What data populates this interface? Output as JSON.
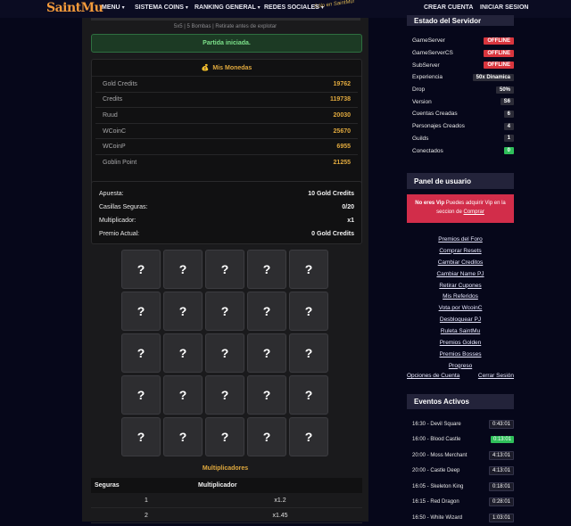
{
  "header": {
    "logo": "SaintMu",
    "logo_tag": "Sólo en SaintMu!",
    "nav": [
      {
        "label": "MENU"
      },
      {
        "label": "SISTEMA COINS"
      },
      {
        "label": "RANKING GENERAL"
      },
      {
        "label": "REDES SOCIALES"
      }
    ],
    "create_account": "CREAR CUENTA",
    "login": "INICIAR SESION"
  },
  "game": {
    "subtitle": "5x5 | 5 Bombas | Retirate antes de explotar",
    "alert": "Partida iniciada.",
    "coins_title": "Mis Monedas",
    "coins": [
      {
        "label": "Gold Credits",
        "value": "19762"
      },
      {
        "label": "Credits",
        "value": "119738"
      },
      {
        "label": "Ruud",
        "value": "20030"
      },
      {
        "label": "WCoinC",
        "value": "25670"
      },
      {
        "label": "WCoinP",
        "value": "6955"
      },
      {
        "label": "Goblin Point",
        "value": "21255"
      }
    ],
    "bet": [
      {
        "label": "Apuesta:",
        "value": "10 Gold Credits"
      },
      {
        "label": "Casillas Seguras:",
        "value": "0/20"
      },
      {
        "label": "Multiplicador:",
        "value": "x1"
      },
      {
        "label": "Premio Actual:",
        "value": "0 Gold Credits"
      }
    ],
    "cell_symbol": "?",
    "multipliers_title": "Multiplicadores",
    "multipliers_headers": [
      "Seguras",
      "Multiplicador"
    ],
    "multipliers": [
      {
        "safe": "1",
        "mult": "x1.2"
      },
      {
        "safe": "2",
        "mult": "x1.45"
      }
    ]
  },
  "sidebar": {
    "server_title": "Estado del Servidor",
    "server": [
      {
        "label": "GameServer",
        "value": "OFFLINE",
        "color": "red"
      },
      {
        "label": "GameServerCS",
        "value": "OFFLINE",
        "color": "red"
      },
      {
        "label": "SubServer",
        "value": "OFFLINE",
        "color": "red"
      },
      {
        "label": "Experiencia",
        "value": "50x Dinamica",
        "color": "gray"
      },
      {
        "label": "Drop",
        "value": "50%",
        "color": "gray"
      },
      {
        "label": "Version",
        "value": "S6",
        "color": "gray"
      },
      {
        "label": "Cuentas Creadas",
        "value": "6",
        "color": "gray"
      },
      {
        "label": "Personajes Creados",
        "value": "4",
        "color": "gray"
      },
      {
        "label": "Guilds",
        "value": "1",
        "color": "gray"
      },
      {
        "label": "Conectados",
        "value": "0",
        "color": "green"
      }
    ],
    "user_panel_title": "Panel de usuario",
    "vip_bold": "No eres Vip",
    "vip_text": " Puedes adquirir Vip en la seccion de ",
    "vip_link": "Comprar",
    "links": [
      "Premios del Foro",
      "Comprar Resets",
      "Cambiar Creditos",
      "Cambiar Name PJ",
      "Retirar Cupones",
      "Mis Referidos",
      "Vota por WcoinC",
      "Desbloquear PJ",
      "Ruleta SaintMu",
      "Premios Golden",
      "Premios Bosses",
      "Progreso"
    ],
    "account_options": "Opciones de Cuenta",
    "logout": "Cerrar Sesión",
    "events_title": "Eventos Activos",
    "events": [
      {
        "time": "16:30",
        "name": "Devil Square",
        "remaining": "0:43:01",
        "active": false
      },
      {
        "time": "16:00",
        "name": "Blood Castle",
        "remaining": "0:13:01",
        "active": true
      },
      {
        "time": "20:00",
        "name": "Moss Merchant",
        "remaining": "4:13:01",
        "active": false
      },
      {
        "time": "20:00",
        "name": "Castle Deep",
        "remaining": "4:13:01",
        "active": false
      },
      {
        "time": "16:05",
        "name": "Skeleton King",
        "remaining": "0:18:01",
        "active": false
      },
      {
        "time": "16:15",
        "name": "Red Dragon",
        "remaining": "0:28:01",
        "active": false
      },
      {
        "time": "16:50",
        "name": "White Wizard",
        "remaining": "1:03:01",
        "active": false
      }
    ]
  }
}
